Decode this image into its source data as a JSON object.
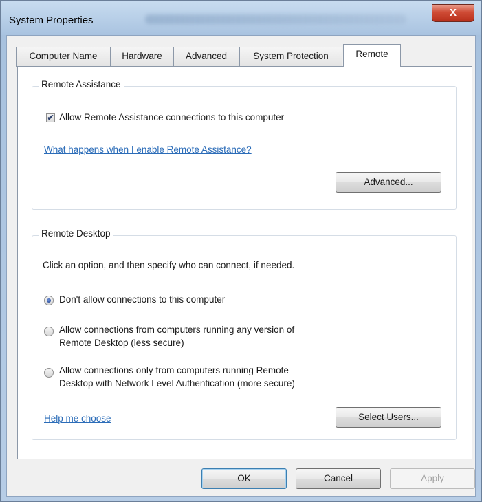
{
  "window": {
    "title": "System Properties",
    "close_label": "X"
  },
  "tabs": [
    {
      "label": "Computer Name",
      "active": false
    },
    {
      "label": "Hardware",
      "active": false
    },
    {
      "label": "Advanced",
      "active": false
    },
    {
      "label": "System Protection",
      "active": false
    },
    {
      "label": "Remote",
      "active": true
    }
  ],
  "remote_assistance": {
    "legend": "Remote Assistance",
    "allow_checkbox": {
      "label": "Allow Remote Assistance connections to this computer",
      "checked": true
    },
    "help_link": "What happens when I enable Remote Assistance?",
    "advanced_button": "Advanced..."
  },
  "remote_desktop": {
    "legend": "Remote Desktop",
    "instruction": "Click an option, and then specify who can connect, if needed.",
    "options": [
      {
        "line1": "Don't allow connections to this computer",
        "line2": "",
        "selected": true
      },
      {
        "line1": "Allow connections from computers running any version of",
        "line2": "Remote Desktop (less secure)",
        "selected": false
      },
      {
        "line1": "Allow connections only from computers running Remote",
        "line2": "Desktop with Network Level Authentication (more secure)",
        "selected": false
      }
    ],
    "help_link": "Help me choose",
    "select_users_button": "Select Users..."
  },
  "footer": {
    "ok": "OK",
    "cancel": "Cancel",
    "apply": "Apply"
  }
}
